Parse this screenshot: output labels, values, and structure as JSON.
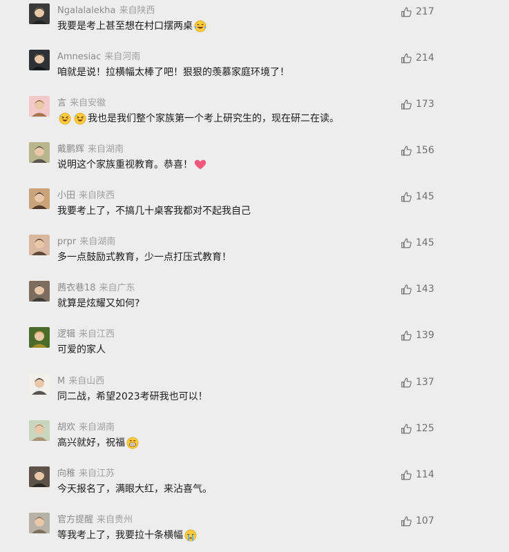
{
  "comments": [
    {
      "nickname": "Ngalalalekha",
      "location": "来自陕西",
      "text_before": "我要是考上甚至想在村口摆两桌",
      "text_after": "",
      "emoji_before": [],
      "emoji_after": [
        "laugh-cry-emoji"
      ],
      "likes": "217",
      "avatar_color": "#3a3a3a"
    },
    {
      "nickname": "Amnesiac",
      "location": "来自河南",
      "text_before": "咱就是说！拉横幅太棒了吧！狠狠的羡慕家庭环境了！",
      "text_after": "",
      "emoji_before": [],
      "emoji_after": [],
      "likes": "214",
      "avatar_color": "#2e3136"
    },
    {
      "nickname": "言",
      "location": "来自安徽",
      "text_before": "",
      "text_after": "我也是我们整个家族第一个考上研究生的，现在研二在读。",
      "emoji_before": [
        "rofl-emoji",
        "rofl-emoji"
      ],
      "emoji_after": [],
      "likes": "173",
      "avatar_color": "#f3c9c9"
    },
    {
      "nickname": "戴鹏辉",
      "location": "来自湖南",
      "text_before": "说明这个家族重视教育。恭喜！",
      "text_after": "",
      "emoji_before": [],
      "emoji_after": [
        "heart-emoji"
      ],
      "likes": "156",
      "avatar_color": "#b9b58c"
    },
    {
      "nickname": "小田",
      "location": "来自陕西",
      "text_before": "我要考上了，不搞几十桌客我都对不起我自己",
      "text_after": "",
      "emoji_before": [],
      "emoji_after": [],
      "likes": "145",
      "avatar_color": "#c9a47a"
    },
    {
      "nickname": "prpr",
      "location": "来自湖南",
      "text_before": "多一点鼓励式教育，少一点打压式教育！",
      "text_after": "",
      "emoji_before": [],
      "emoji_after": [],
      "likes": "145",
      "avatar_color": "#d8b8a0"
    },
    {
      "nickname": "茜衣巷18",
      "location": "来自广东",
      "text_before": "就算是炫耀又如何?",
      "text_after": "",
      "emoji_before": [],
      "emoji_after": [],
      "likes": "143",
      "avatar_color": "#7d6d5e"
    },
    {
      "nickname": "逻辑",
      "location": "来自江西",
      "text_before": "可爱的家人",
      "text_after": "",
      "emoji_before": [],
      "emoji_after": [],
      "likes": "139",
      "avatar_color": "#4b6b2a"
    },
    {
      "nickname": "M",
      "location": "来自山西",
      "text_before": "同二战，希望2023考研我也可以！",
      "text_after": "",
      "emoji_before": [],
      "emoji_after": [],
      "likes": "137",
      "avatar_color": "#f2f0ea"
    },
    {
      "nickname": "胡欢",
      "location": "来自湖南",
      "text_before": "高兴就好，祝福",
      "text_after": "",
      "emoji_before": [],
      "emoji_after": [
        "grin-emoji"
      ],
      "likes": "125",
      "avatar_color": "#c8d6c0"
    },
    {
      "nickname": "向稚",
      "location": "来自江苏",
      "text_before": "今天报名了，满眼大红，来沾喜气。",
      "text_after": "",
      "emoji_before": [],
      "emoji_after": [],
      "likes": "114",
      "avatar_color": "#5c5247"
    },
    {
      "nickname": "官方提醒",
      "location": "来自贵州",
      "text_before": "等我考上了，我要拉十条横幅",
      "text_after": "",
      "emoji_before": [],
      "emoji_after": [
        "cry-emoji"
      ],
      "likes": "107",
      "avatar_color": "#b8b2a6"
    }
  ],
  "colors": {
    "background": "#ededed",
    "nickname": "#8a8a8a",
    "text": "#1a1a1a",
    "like": "#6f6f6f"
  }
}
